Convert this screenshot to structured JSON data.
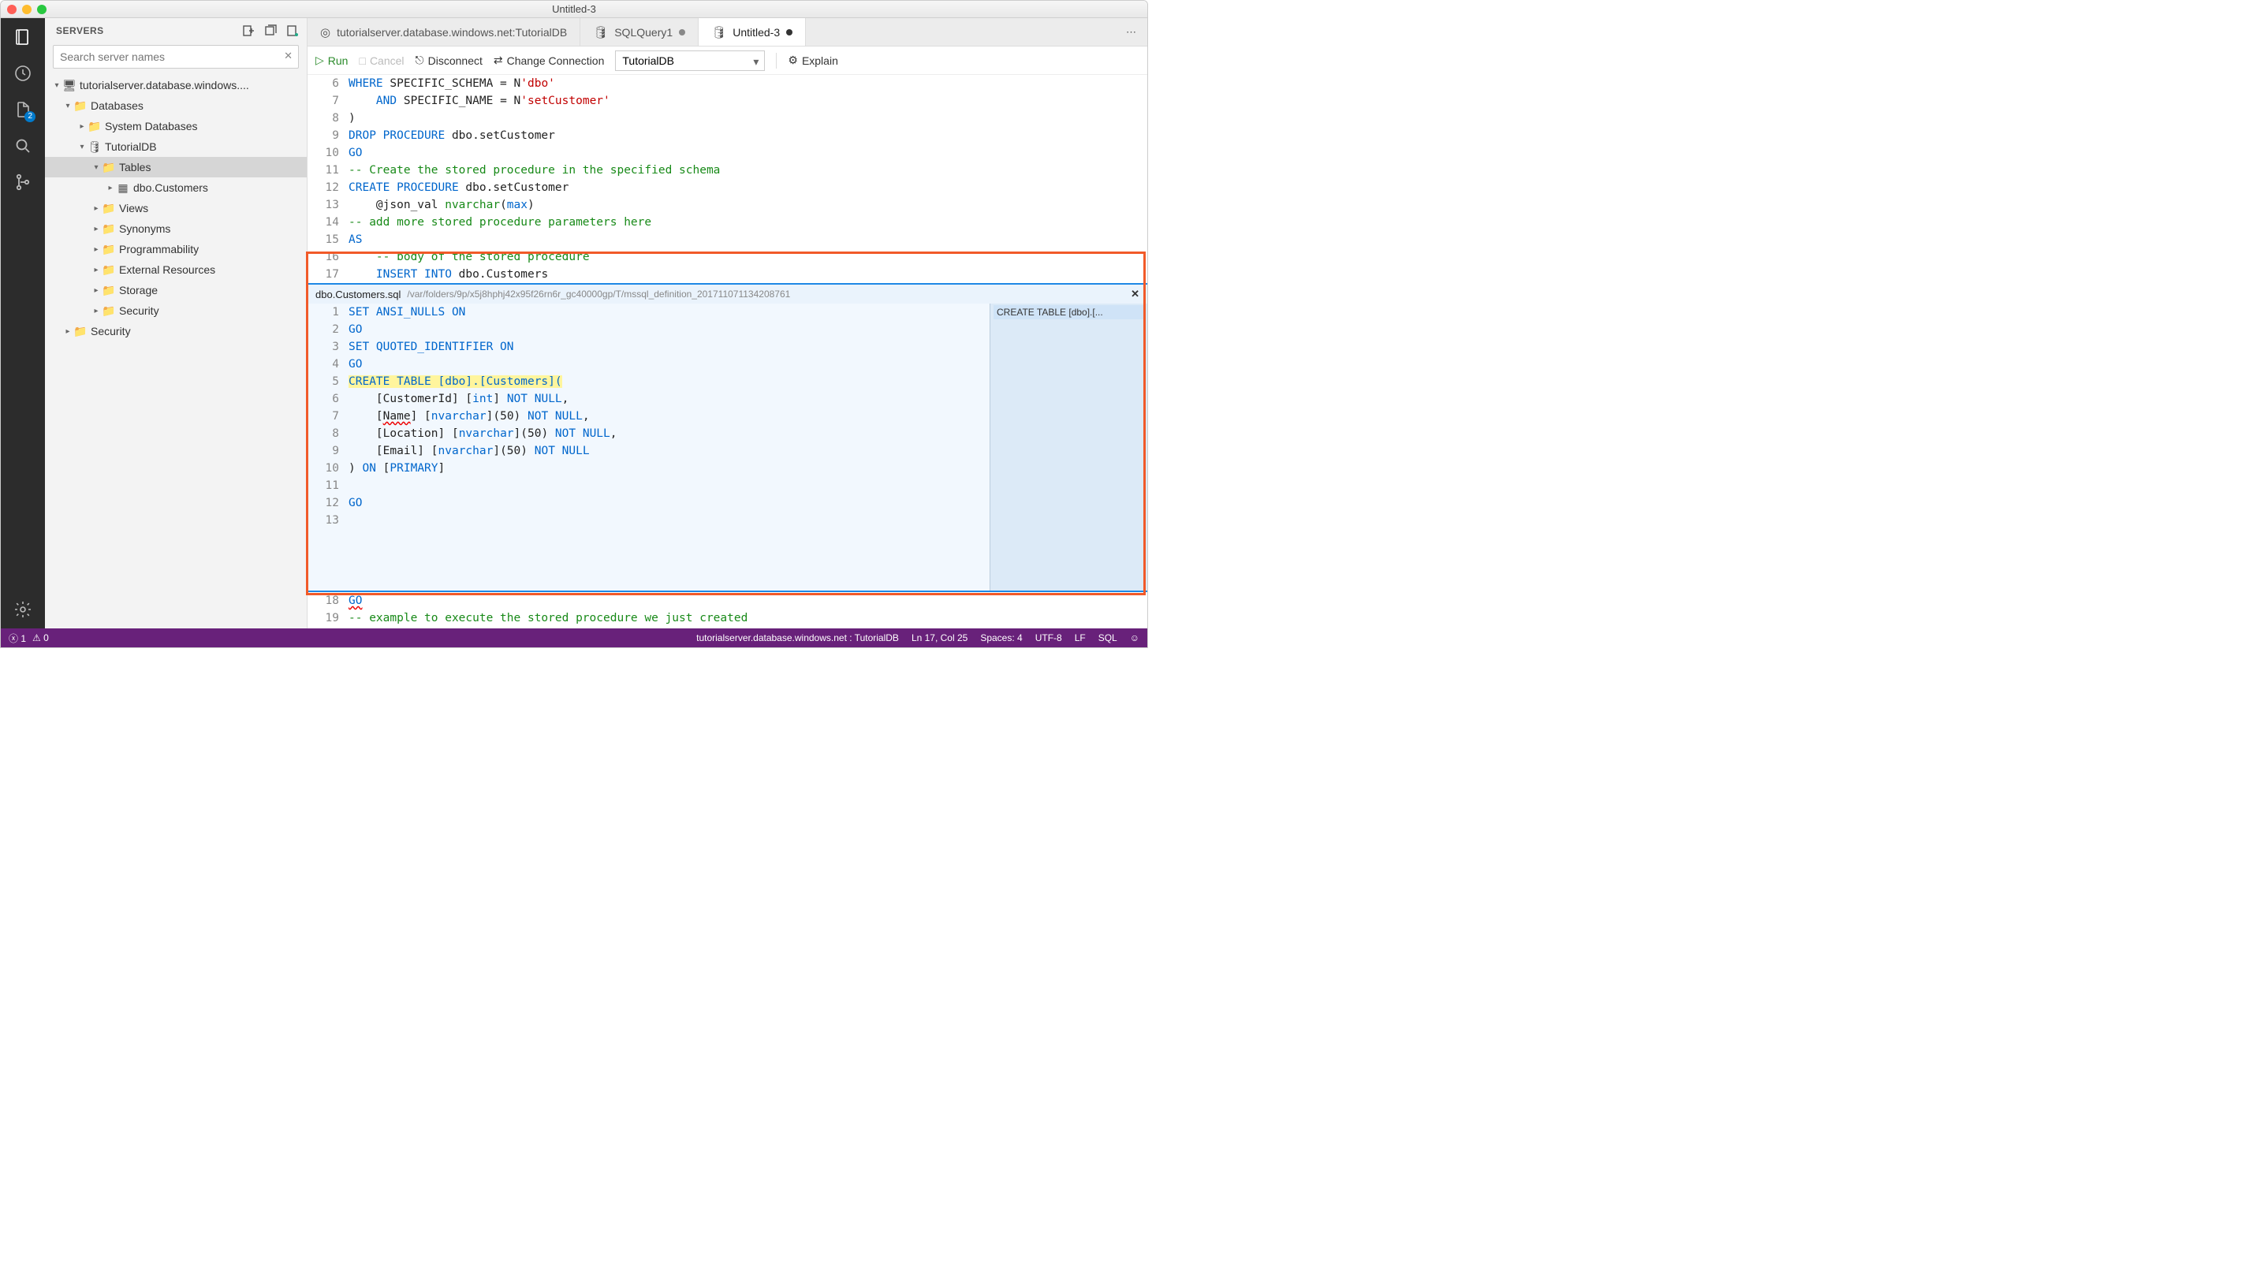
{
  "window": {
    "title": "Untitled-3"
  },
  "activitybar": {
    "explorer_badge": "2"
  },
  "sidebar": {
    "title": "SERVERS",
    "search_placeholder": "Search server names",
    "tree": {
      "server": "tutorialserver.database.windows....",
      "databases": "Databases",
      "system_db": "System Databases",
      "tutorialdb": "TutorialDB",
      "tables": "Tables",
      "dbo_customers": "dbo.Customers",
      "views": "Views",
      "synonyms": "Synonyms",
      "programmability": "Programmability",
      "ext_resources": "External Resources",
      "storage": "Storage",
      "security": "Security",
      "security2": "Security"
    }
  },
  "tabs": {
    "t1": "tutorialserver.database.windows.net:TutorialDB",
    "t2": "SQLQuery1",
    "t3": "Untitled-3"
  },
  "toolbar": {
    "run": "Run",
    "cancel": "Cancel",
    "disconnect": "Disconnect",
    "change_conn": "Change Connection",
    "db_selected": "TutorialDB",
    "explain": "Explain"
  },
  "editor_top": {
    "lines": [
      "6",
      "7",
      "8",
      "9",
      "10",
      "11",
      "12",
      "13",
      "14",
      "15",
      "16",
      "17"
    ],
    "code": [
      {
        "segs": [
          {
            "t": "WHERE",
            "c": "kw"
          },
          {
            "t": " SPECIFIC_SCHEMA = N"
          },
          {
            "t": "'dbo'",
            "c": "str"
          }
        ]
      },
      {
        "segs": [
          {
            "t": "    "
          },
          {
            "t": "AND",
            "c": "kw"
          },
          {
            "t": " SPECIFIC_NAME = N"
          },
          {
            "t": "'setCustomer'",
            "c": "str"
          }
        ]
      },
      {
        "segs": [
          {
            "t": ")"
          }
        ]
      },
      {
        "segs": [
          {
            "t": "DROP PROCEDURE",
            "c": "kw"
          },
          {
            "t": " dbo.setCustomer"
          }
        ]
      },
      {
        "segs": [
          {
            "t": "GO",
            "c": "kw"
          }
        ]
      },
      {
        "segs": [
          {
            "t": "-- Create the stored procedure in the specified schema",
            "c": "cm"
          }
        ]
      },
      {
        "segs": [
          {
            "t": "CREATE PROCEDURE",
            "c": "kw"
          },
          {
            "t": " dbo.setCustomer"
          }
        ]
      },
      {
        "segs": [
          {
            "t": "    @json_val "
          },
          {
            "t": "nvarchar",
            "c": "type"
          },
          {
            "t": "("
          },
          {
            "t": "max",
            "c": "kw"
          },
          {
            "t": ")"
          }
        ]
      },
      {
        "segs": [
          {
            "t": "-- add more stored procedure parameters here",
            "c": "cm"
          }
        ]
      },
      {
        "segs": [
          {
            "t": "AS",
            "c": "kw"
          }
        ]
      },
      {
        "segs": [
          {
            "t": "    "
          },
          {
            "t": "-- body of the stored procedure",
            "c": "cm"
          }
        ]
      },
      {
        "segs": [
          {
            "t": "    "
          },
          {
            "t": "INSERT INTO",
            "c": "kw"
          },
          {
            "t": " dbo.Customers"
          }
        ]
      }
    ]
  },
  "peek": {
    "file": "dbo.Customers.sql",
    "path": "/var/folders/9p/x5j8hphj42x95f26rn6r_gc40000gp/T/mssql_definition_201711071134208761",
    "ref": "CREATE TABLE [dbo].[...",
    "lines": [
      "1",
      "2",
      "3",
      "4",
      "5",
      "6",
      "7",
      "8",
      "9",
      "10",
      "11",
      "12",
      "13"
    ],
    "code": [
      {
        "segs": [
          {
            "t": "SET ANSI_NULLS ON",
            "c": "kw"
          }
        ]
      },
      {
        "segs": [
          {
            "t": "GO",
            "c": "kw"
          }
        ]
      },
      {
        "segs": [
          {
            "t": "SET QUOTED_IDENTIFIER ON",
            "c": "kw"
          }
        ]
      },
      {
        "segs": [
          {
            "t": "GO",
            "c": "kw"
          }
        ]
      },
      {
        "segs": [
          {
            "t": "CREATE TABLE [dbo].[Customers](",
            "c": "kw",
            "hl": true
          }
        ]
      },
      {
        "segs": [
          {
            "t": "    [CustomerId] ["
          },
          {
            "t": "int",
            "c": "kw"
          },
          {
            "t": "] "
          },
          {
            "t": "NOT NULL",
            "c": "kw"
          },
          {
            "t": ","
          }
        ]
      },
      {
        "segs": [
          {
            "t": "    ["
          },
          {
            "t": "Name",
            "c": "squiggle"
          },
          {
            "t": "] ["
          },
          {
            "t": "nvarchar",
            "c": "kw"
          },
          {
            "t": "](50) "
          },
          {
            "t": "NOT NULL",
            "c": "kw"
          },
          {
            "t": ","
          }
        ]
      },
      {
        "segs": [
          {
            "t": "    [Location] ["
          },
          {
            "t": "nvarchar",
            "c": "kw"
          },
          {
            "t": "](50) "
          },
          {
            "t": "NOT NULL",
            "c": "kw"
          },
          {
            "t": ","
          }
        ]
      },
      {
        "segs": [
          {
            "t": "    [Email] ["
          },
          {
            "t": "nvarchar",
            "c": "kw"
          },
          {
            "t": "](50) "
          },
          {
            "t": "NOT NULL",
            "c": "kw"
          }
        ]
      },
      {
        "segs": [
          {
            "t": ") "
          },
          {
            "t": "ON",
            "c": "kw"
          },
          {
            "t": " ["
          },
          {
            "t": "PRIMARY",
            "c": "kw"
          },
          {
            "t": "]"
          }
        ]
      },
      {
        "segs": [
          {
            "t": " "
          }
        ]
      },
      {
        "segs": [
          {
            "t": "GO",
            "c": "kw"
          }
        ]
      },
      {
        "segs": [
          {
            "t": " "
          }
        ]
      }
    ]
  },
  "editor_bottom": {
    "lines": [
      "18",
      "19"
    ],
    "code": [
      {
        "segs": [
          {
            "t": "GO",
            "c": "kw squiggle"
          }
        ]
      },
      {
        "segs": [
          {
            "t": "-- example to execute the stored procedure we just created",
            "c": "cm"
          }
        ]
      }
    ]
  },
  "statusbar": {
    "errors": "1",
    "warnings": "0",
    "connection": "tutorialserver.database.windows.net : TutorialDB",
    "position": "Ln 17, Col 25",
    "spaces": "Spaces: 4",
    "encoding": "UTF-8",
    "eol": "LF",
    "lang": "SQL"
  }
}
